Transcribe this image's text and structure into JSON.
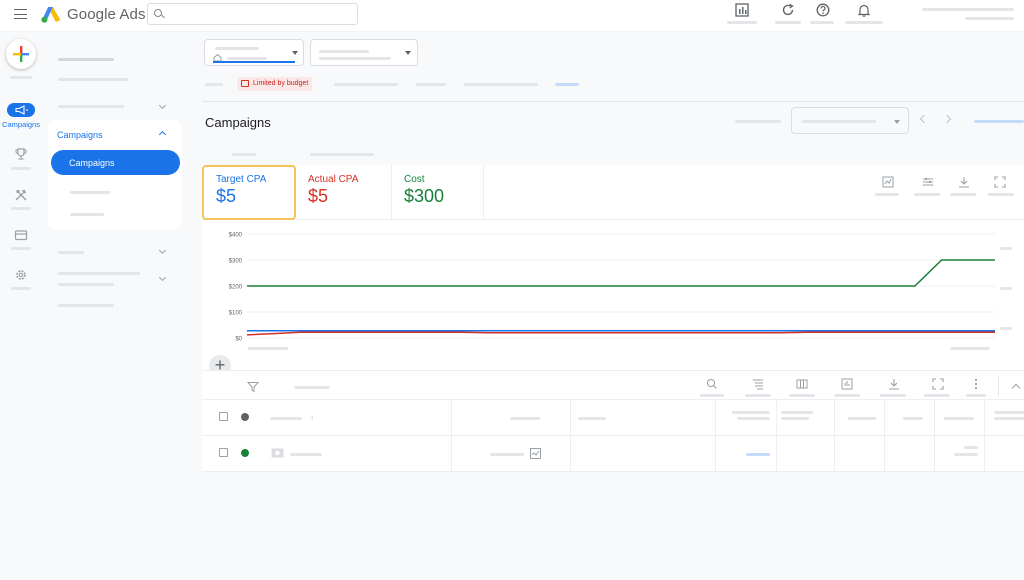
{
  "header": {
    "brand": "Google Ads",
    "search_placeholder": ""
  },
  "rail": {
    "active_label": "Campaigns"
  },
  "sidebar": {
    "section_title": "Campaigns",
    "active_item": "Campaigns"
  },
  "main": {
    "budget_chip": "Limited by budget",
    "page_title": "Campaigns"
  },
  "scorecards": [
    {
      "label": "Target CPA",
      "value": "$5",
      "color": "#1a73e8"
    },
    {
      "label": "Actual CPA",
      "value": "$5",
      "color": "#d93025"
    },
    {
      "label": "Cost",
      "value": "$300",
      "color": "#188038"
    }
  ],
  "chart_data": {
    "type": "line",
    "y_ticks": [
      "$400",
      "$300",
      "$200",
      "$100",
      "$0"
    ],
    "ylim": [
      0,
      400
    ],
    "grid": true,
    "series": [
      {
        "color": "#188038",
        "values": [
          200,
          200,
          200,
          200,
          200,
          200,
          200,
          200,
          200,
          200,
          200,
          200,
          200,
          200,
          200,
          200,
          200,
          200,
          200,
          200,
          200,
          200,
          200,
          200,
          200,
          200,
          300,
          300,
          300
        ]
      },
      {
        "color": "#1a73e8",
        "values": [
          28,
          28,
          28,
          28,
          28,
          28,
          28,
          28,
          28,
          28,
          28,
          28,
          28,
          28,
          28,
          28,
          28,
          28,
          28,
          28,
          28,
          28,
          28,
          28,
          28,
          28,
          28,
          28,
          28
        ]
      },
      {
        "color": "#d93025",
        "values": [
          12,
          17,
          22,
          22,
          22,
          22,
          22,
          22,
          22,
          20,
          20,
          20,
          20,
          20,
          20,
          20,
          20,
          20,
          20,
          20,
          20,
          22,
          22,
          22,
          22,
          22,
          22,
          22,
          22
        ]
      }
    ]
  },
  "table": {
    "rows": [
      {
        "status_color": "#5f6368"
      },
      {
        "status_color": "#188038"
      }
    ]
  },
  "colors": {
    "accent": "#1a73e8",
    "highlight": "#f6c35b"
  }
}
